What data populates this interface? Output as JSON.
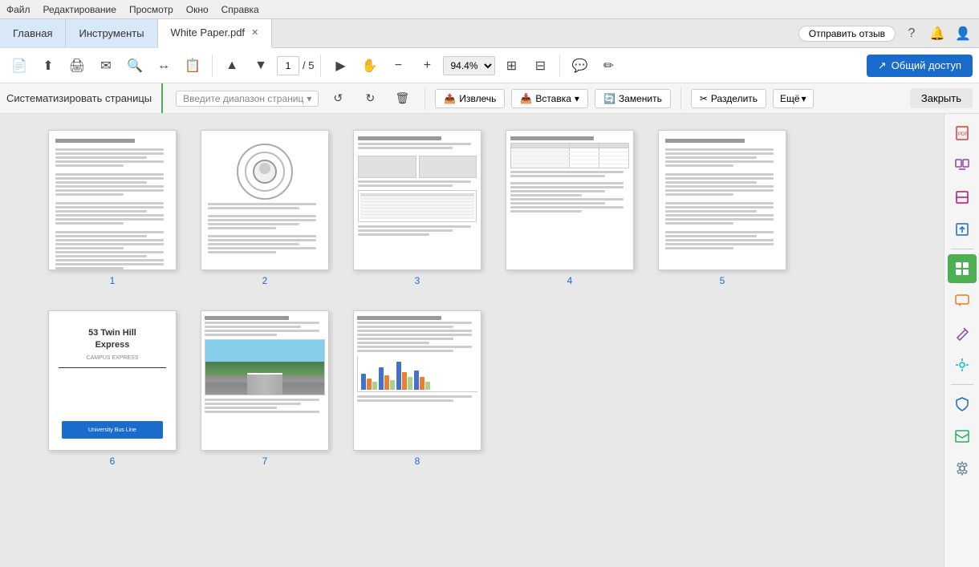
{
  "menu": {
    "items": [
      "Файл",
      "Редактирование",
      "Просмотр",
      "Окно",
      "Справка"
    ]
  },
  "tabs": {
    "home": "Главная",
    "tools": "Инструменты",
    "file": "White Paper.pdf",
    "feedback": "Отправить отзыв"
  },
  "toolbar": {
    "page_current": "1",
    "page_total": "5",
    "zoom": "94.4%",
    "share": "Общий доступ"
  },
  "organize_bar": {
    "title": "Систематизировать страницы",
    "page_range": "Введите диапазон страниц",
    "extract": "Извлечь",
    "insert": "Вставка",
    "replace": "Заменить",
    "split": "Разделить",
    "more": "Ещё",
    "close": "Закрыть"
  },
  "pages": [
    {
      "num": "1"
    },
    {
      "num": "2"
    },
    {
      "num": "3"
    },
    {
      "num": "4"
    },
    {
      "num": "5"
    },
    {
      "num": "6",
      "type": "title_page",
      "title": "53 Twin Hill Express",
      "subtitle": "CAMPUS EXPRESS"
    },
    {
      "num": "7",
      "type": "photo_page"
    },
    {
      "num": "8",
      "type": "chart_page"
    }
  ],
  "right_sidebar": {
    "icons": [
      {
        "name": "pdf-icon",
        "color": "red",
        "symbol": "📄"
      },
      {
        "name": "combine-icon",
        "color": "purple",
        "symbol": "⧉"
      },
      {
        "name": "compress-icon",
        "color": "pink",
        "symbol": "⊟"
      },
      {
        "name": "export-icon",
        "color": "blue",
        "symbol": "↗"
      },
      {
        "name": "organize-icon",
        "color": "green",
        "symbol": "▦",
        "active": true
      },
      {
        "name": "comment-icon",
        "color": "orange",
        "symbol": "💬"
      },
      {
        "name": "edit-icon",
        "color": "purple",
        "symbol": "✏"
      },
      {
        "name": "xray-icon",
        "color": "teal",
        "symbol": "⛭"
      },
      {
        "name": "protect-icon",
        "color": "blue",
        "symbol": "🛡"
      },
      {
        "name": "export2-icon",
        "color": "cyan",
        "symbol": "⤴"
      },
      {
        "name": "settings-icon",
        "color": "gray",
        "symbol": "⚙"
      }
    ]
  }
}
